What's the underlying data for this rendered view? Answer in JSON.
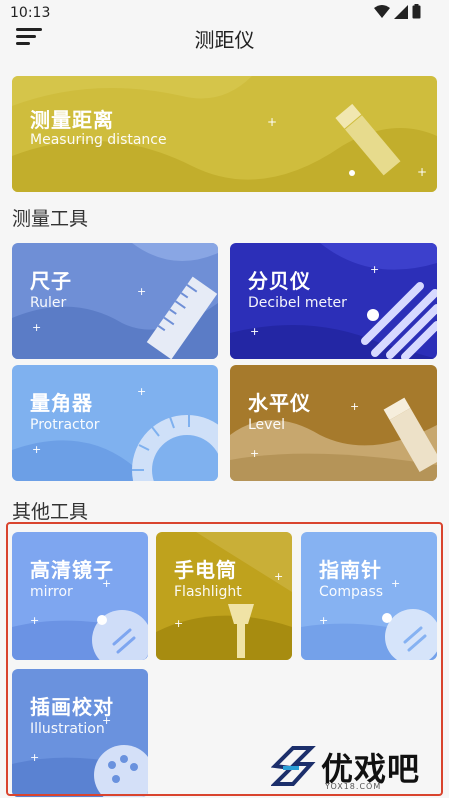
{
  "status": {
    "time": "10:13"
  },
  "app": {
    "title": "测距仪"
  },
  "banner": {
    "cn": "测量距离",
    "en": "Measuring distance",
    "color": "#cfbd3d"
  },
  "sections": {
    "measure": "测量工具",
    "other": "其他工具"
  },
  "measure_tools": [
    {
      "cn": "尺子",
      "en": "Ruler",
      "color": "#6f8fd6",
      "icon": "ruler-icon"
    },
    {
      "cn": "分贝仪",
      "en": "Decibel meter",
      "color": "#2c2fb8",
      "icon": "sound-wave-icon"
    },
    {
      "cn": "量角器",
      "en": "Protractor",
      "color": "#7fb1ef",
      "icon": "protractor-icon"
    },
    {
      "cn": "水平仪",
      "en": "Level",
      "color": "#a67a2c",
      "icon": "level-icon"
    }
  ],
  "other_tools": [
    {
      "cn": "高清镜子",
      "en": "mirror",
      "color": "#7ea6f0",
      "icon": "mirror-icon"
    },
    {
      "cn": "手电筒",
      "en": "Flashlight",
      "color": "#bfa21d",
      "icon": "flashlight-icon"
    },
    {
      "cn": "指南针",
      "en": "Compass",
      "color": "#86b2f2",
      "icon": "compass-icon"
    },
    {
      "cn": "插画校对",
      "en": "Illustration",
      "color": "#6a92de",
      "icon": "palette-icon"
    }
  ],
  "watermark": {
    "text": "优戏吧",
    "url": "YOX18.COM"
  }
}
